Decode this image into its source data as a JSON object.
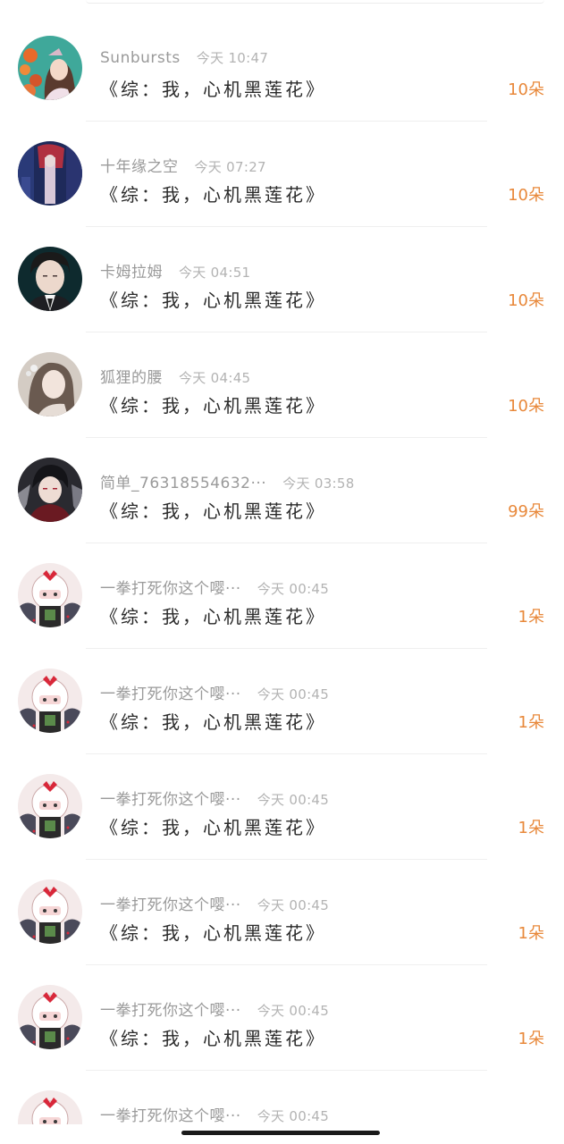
{
  "messages": [
    {
      "name": "Sunbursts",
      "time": "今天 10:47",
      "title": "《综：我，心机黑莲花》",
      "gift": "10朵",
      "avatar": "sunbursts-avatar"
    },
    {
      "name": "十年缘之空",
      "time": "今天 07:27",
      "title": "《综：我，心机黑莲花》",
      "gift": "10朵",
      "avatar": "ten-years-avatar"
    },
    {
      "name": "卡姆拉姆",
      "time": "今天 04:51",
      "title": "《综：我，心机黑莲花》",
      "gift": "10朵",
      "avatar": "kamulamu-avatar"
    },
    {
      "name": "狐狸的腰",
      "time": "今天 04:45",
      "title": "《综：我，心机黑莲花》",
      "gift": "10朵",
      "avatar": "fox-waist-avatar"
    },
    {
      "name": "简单_76318554632···",
      "time": "今天 03:58",
      "title": "《综：我，心机黑莲花》",
      "gift": "99朵",
      "avatar": "jiandan-avatar"
    },
    {
      "name": "一拳打死你这个嘤···",
      "time": "今天 00:45",
      "title": "《综：我，心机黑莲花》",
      "gift": "1朵",
      "avatar": "punch-avatar"
    },
    {
      "name": "一拳打死你这个嘤···",
      "time": "今天 00:45",
      "title": "《综：我，心机黑莲花》",
      "gift": "1朵",
      "avatar": "punch-avatar"
    },
    {
      "name": "一拳打死你这个嘤···",
      "time": "今天 00:45",
      "title": "《综：我，心机黑莲花》",
      "gift": "1朵",
      "avatar": "punch-avatar"
    },
    {
      "name": "一拳打死你这个嘤···",
      "time": "今天 00:45",
      "title": "《综：我，心机黑莲花》",
      "gift": "1朵",
      "avatar": "punch-avatar"
    },
    {
      "name": "一拳打死你这个嘤···",
      "time": "今天 00:45",
      "title": "《综：我，心机黑莲花》",
      "gift": "1朵",
      "avatar": "punch-avatar"
    },
    {
      "name": "一拳打死你这个嘤···",
      "time": "今天 00:45",
      "title": "",
      "gift": "",
      "avatar": "punch-avatar"
    }
  ],
  "colors": {
    "gift": "#e8883a",
    "name": "#9a9a9a",
    "time": "#b3b3b3",
    "title": "#2a2a2a"
  }
}
